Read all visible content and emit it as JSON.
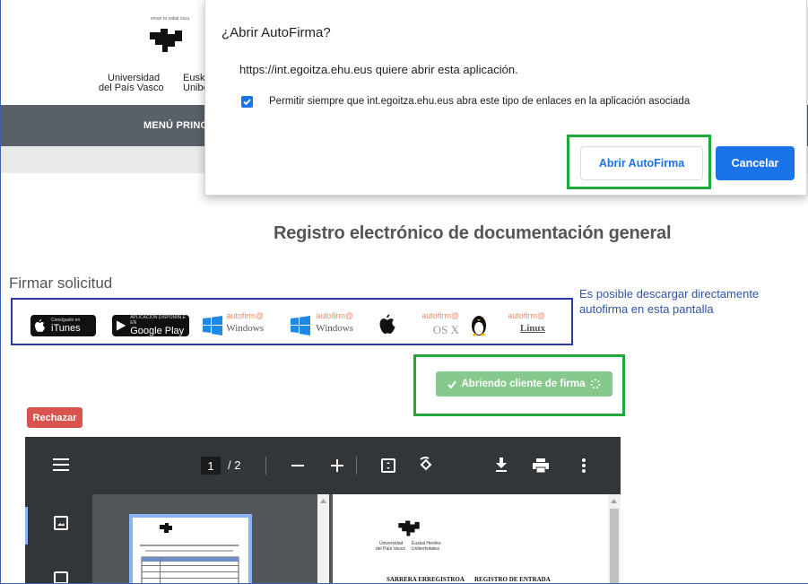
{
  "header": {
    "logo_top": "eman ta zabal zazu",
    "logo_line1_left": "Universidad",
    "logo_line2_left": "del País Vasco",
    "logo_line1_right": "Eusk",
    "logo_line2_right": "Unibe",
    "nav_item": "MENÚ PRINC"
  },
  "dialog": {
    "title": "¿Abrir AutoFirma?",
    "message": "https://int.egoitza.ehu.eus quiere abrir esta aplicación.",
    "checkbox_label": "Permitir siempre que int.egoitza.ehu.eus abra este tipo de enlaces en la aplicación asociada",
    "checkbox_checked": true,
    "open_button": "Abrir AutoFirma",
    "cancel_button": "Cancelar"
  },
  "page": {
    "heading": "Registro electrónico de documentación general",
    "sign_heading": "Firmar solicitud",
    "annotation": "Es posible descargar directamente autofirma en esta pantalla",
    "opening_button": "Abriendo cliente de firma",
    "reject_button": "Rechazar"
  },
  "downloads": [
    {
      "small": "Consíguelo en",
      "big": "iTunes",
      "icon": "apple-icon"
    },
    {
      "small": "APLICACIÓN DISPONIBLE EN",
      "big": "Google Play",
      "icon": "play-icon"
    },
    {
      "brand": "autofirm@",
      "os": "Windows",
      "icon": "windows-icon"
    },
    {
      "brand": "autofirm@",
      "os": "Windows",
      "icon": "windows-icon"
    },
    {
      "brand": "autofirm@",
      "os": "OS X",
      "icon": "apple-icon"
    },
    {
      "brand": "autofirm@",
      "os": "Linux",
      "icon": "tux-icon"
    }
  ],
  "viewer": {
    "current_page": "1",
    "total_pages": "/ 2",
    "doc_line1": "SARRERA ERREGISTROA",
    "doc_line2": "REGISTRO DE ENTRADA",
    "doc_logo_left1": "Universidad",
    "doc_logo_left2": "del País Vasco",
    "doc_logo_right1": "Euskal Herriko",
    "doc_logo_right2": "Unibertsitatea"
  },
  "colors": {
    "accent": "#1a73e8",
    "highlight_green": "#22a83a",
    "annotation_blue": "#2f54a8",
    "reject_red": "#d9534f",
    "opening_green": "#86c88d"
  }
}
